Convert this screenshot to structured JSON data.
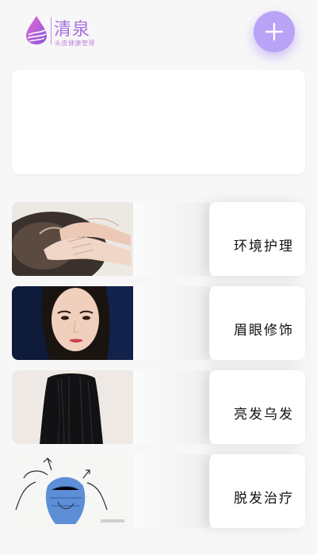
{
  "app": {
    "logo_title": "清泉",
    "logo_subtitle": "头皮健康管理"
  },
  "header": {
    "add_button_icon": "plus-icon"
  },
  "colors": {
    "brand": "#a770e0",
    "accent_button": "#b8a3f7"
  },
  "services": [
    {
      "label": "环境护理",
      "image": "hands-massaging-scalp"
    },
    {
      "label": "眉眼修饰",
      "image": "woman-face-portrait"
    },
    {
      "label": "亮发乌发",
      "image": "long-black-straight-hair"
    },
    {
      "label": "脱发治疗",
      "image": "hair-loss-illustration"
    }
  ]
}
